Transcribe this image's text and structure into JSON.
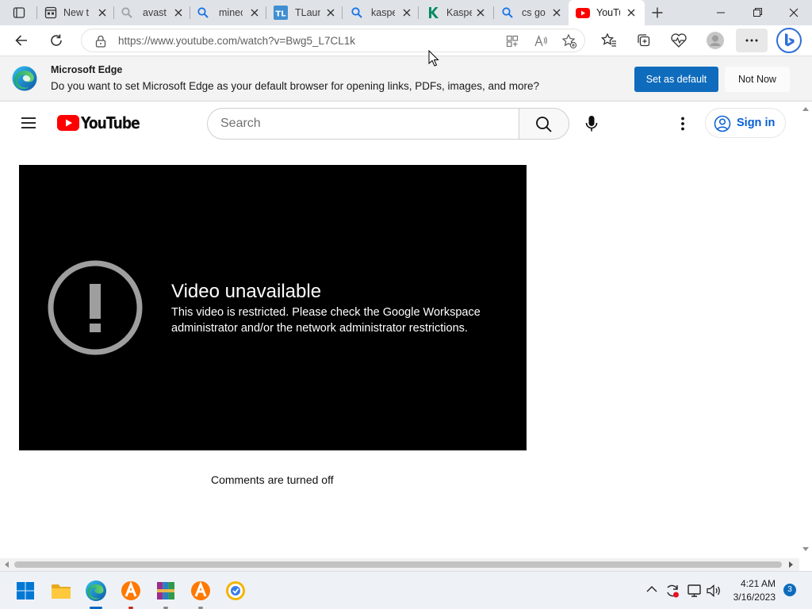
{
  "browser": {
    "tabs": [
      {
        "title": "New t",
        "icon": "new-tab-icon"
      },
      {
        "title": "avast",
        "icon": "search-icon"
      },
      {
        "title": "minec",
        "icon": "search-icon"
      },
      {
        "title": "TLaun",
        "icon": "tlauncher-icon"
      },
      {
        "title": "kaspe",
        "icon": "search-icon"
      },
      {
        "title": "Kaspe",
        "icon": "kaspersky-icon"
      },
      {
        "title": "cs go",
        "icon": "search-icon"
      },
      {
        "title": "YouTu",
        "icon": "youtube-icon",
        "active": true
      }
    ],
    "url": "https://www.youtube.com/watch?v=Bwg5_L7CL1k",
    "accent": "#0f6cbd"
  },
  "infobar": {
    "title": "Microsoft Edge",
    "message": "Do you want to set Microsoft Edge as your default browser for opening links, PDFs, images, and more?",
    "set_default": "Set as default",
    "not_now": "Not Now"
  },
  "youtube": {
    "logo_text": "YouTube",
    "search_placeholder": "Search",
    "sign_in": "Sign in",
    "error_title": "Video unavailable",
    "error_message": "This video is restricted. Please check the Google Workspace administrator and/or the network administrator restrictions.",
    "comments_off": "Comments are turned off",
    "brand_red": "#ff0000",
    "link_blue": "#065fd4"
  },
  "taskbar": {
    "time": "4:21 AM",
    "date": "3/16/2023",
    "notification_count": "3"
  }
}
